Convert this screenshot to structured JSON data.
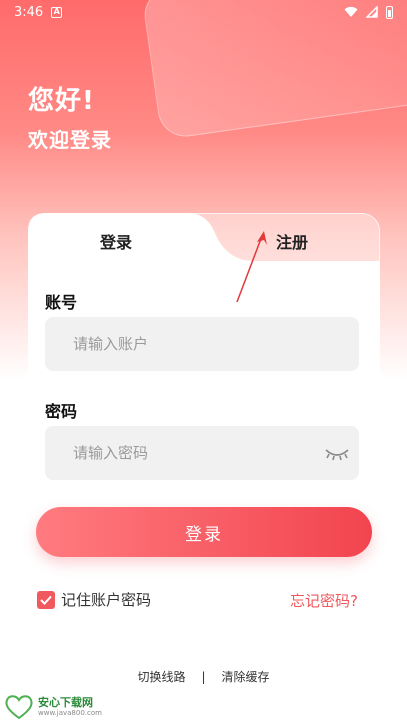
{
  "status_bar": {
    "time": "3:46",
    "notification_icon": "A"
  },
  "greeting": {
    "hello": "您好!",
    "welcome": "欢迎登录"
  },
  "tabs": {
    "login": "登录",
    "register": "注册"
  },
  "form": {
    "account_label": "账号",
    "account_placeholder": "请输入账户",
    "password_label": "密码",
    "password_placeholder": "请输入密码"
  },
  "actions": {
    "login_button": "登录",
    "remember_label": "记住账户密码",
    "remember_checked": true,
    "forgot_password": "忘记密码?"
  },
  "footer": {
    "switch_line": "切换线路",
    "separator": "|",
    "clear_cache": "清除缓存"
  },
  "watermark": {
    "name": "安心下载网",
    "url": "www.java800.com"
  },
  "colors": {
    "accent": "#f0585d",
    "gradient_start": "#ff7b7f",
    "gradient_end": "#f2444f"
  }
}
